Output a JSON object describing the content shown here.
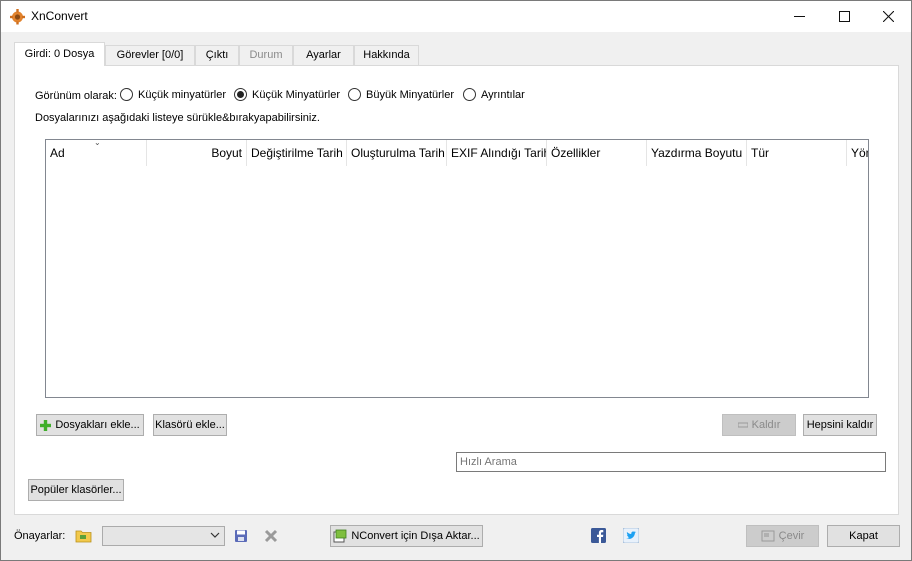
{
  "window": {
    "title": "XnConvert",
    "controls": [
      "minimize",
      "maximize",
      "close"
    ]
  },
  "tabs": [
    {
      "label": "Girdi: 0 Dosya",
      "active": true,
      "disabled": false
    },
    {
      "label": "Görevler [0/0]",
      "active": false,
      "disabled": false
    },
    {
      "label": "Çıktı",
      "active": false,
      "disabled": false
    },
    {
      "label": "Durum",
      "active": false,
      "disabled": true
    },
    {
      "label": "Ayarlar",
      "active": false,
      "disabled": false
    },
    {
      "label": "Hakkında",
      "active": false,
      "disabled": false
    }
  ],
  "view": {
    "label": "Görünüm olarak:",
    "options": [
      {
        "label": "Küçük minyatürler",
        "selected": false
      },
      {
        "label": "Küçük Minyatürler",
        "selected": true
      },
      {
        "label": "Büyük Minyatürler",
        "selected": false
      },
      {
        "label": "Ayrıntılar",
        "selected": false
      }
    ]
  },
  "hint": "Dosyalarınızı aşağıdaki listeye sürükle&bırakyapabilirsiniz.",
  "file_list": {
    "columns": [
      "Ad",
      "Boyut",
      "Değiştirilme Tarih",
      "Oluşturulma Tarih",
      "EXIF Alındığı Tarih",
      "Özellikler",
      "Yazdırma Boyutu",
      "Tür",
      "Yön"
    ],
    "rows": []
  },
  "buttons": {
    "add_files": "Dosyakları ekle...",
    "add_folder": "Klasörü ekle...",
    "remove": "Kaldır",
    "remove_all": "Hepsini kaldır",
    "popular_folders": "Popüler klasörler..."
  },
  "search": {
    "placeholder": "Hızlı Arama",
    "value": ""
  },
  "bottom": {
    "presets_label": "Önayarlar:",
    "preset_value": "",
    "export": "NConvert için Dışa Aktar...",
    "convert": "Çevir",
    "close": "Kapat"
  },
  "colors": {
    "facebook": "#3b5998",
    "twitter": "#1da1f2",
    "add_green": "#3fae2a"
  }
}
